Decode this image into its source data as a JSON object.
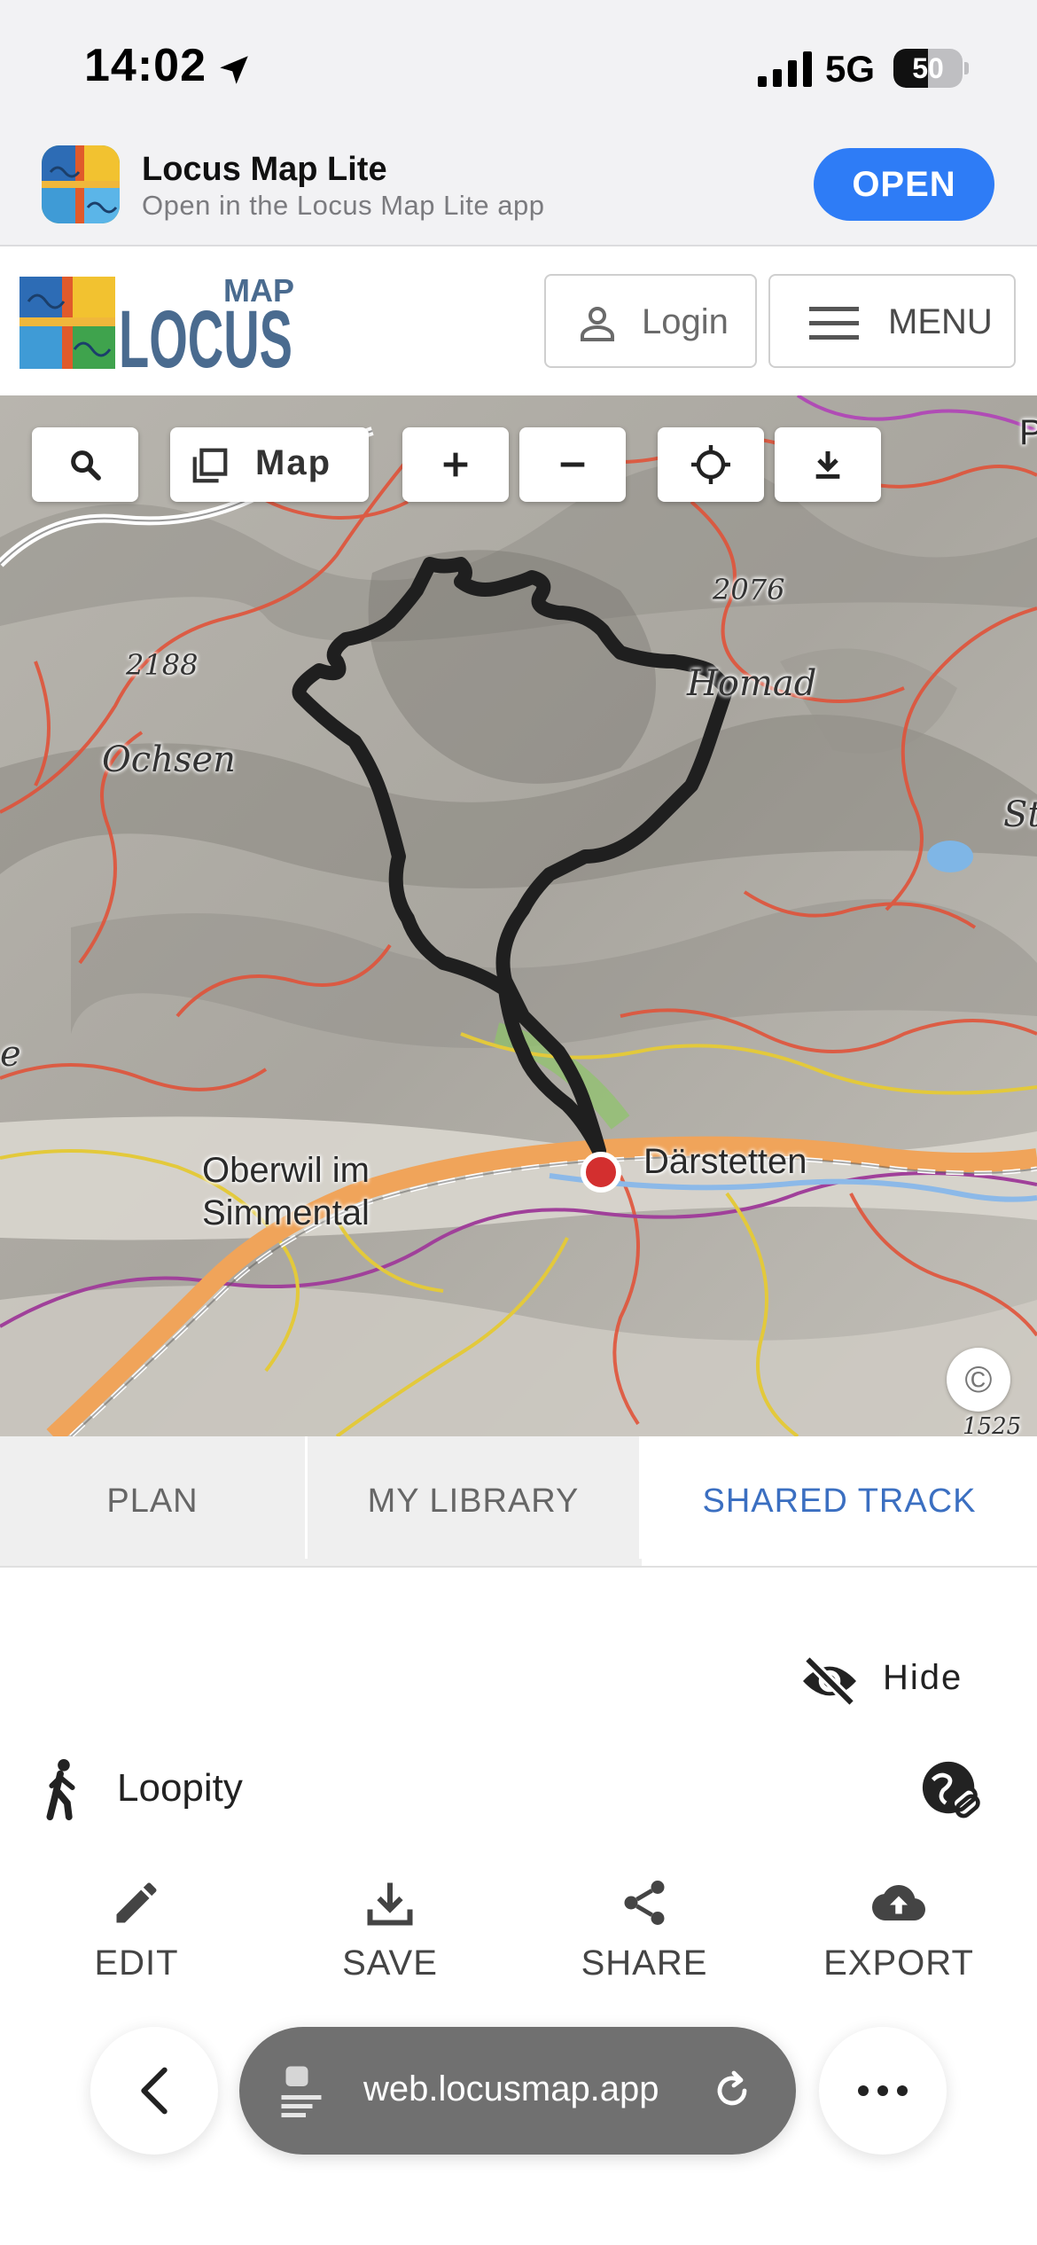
{
  "status_bar": {
    "time": "14:02",
    "network": "5G",
    "battery": "50",
    "battery_level": 0.5
  },
  "app_banner": {
    "title": "Locus Map Lite",
    "subtitle": "Open in the Locus Map Lite app",
    "open_label": "OPEN"
  },
  "header": {
    "logo_small": "MAP",
    "logo_big": "LOCUS",
    "login_label": "Login",
    "menu_label": "MENU"
  },
  "map": {
    "layer_label": "Map",
    "route_color": "#1f1f1f",
    "marker_color": "#d32f2f",
    "labels": {
      "peak_2076": "2076",
      "peak_2188": "2188",
      "homad": "Homad",
      "ochsen": "Ochsen",
      "st": "St",
      "e": "e",
      "p": "P",
      "darstetten": "Därstetten",
      "oberwil_1": "Oberwil im",
      "oberwil_2": "Simmental",
      "peak_1525": "1525"
    },
    "copyright": "©"
  },
  "tabs": {
    "plan": "PLAN",
    "library": "MY LIBRARY",
    "shared": "SHARED TRACK",
    "active_color": "#3b6fc1"
  },
  "panel": {
    "hide_label": "Hide",
    "track_name": "Loopity",
    "actions": {
      "edit": "EDIT",
      "save": "SAVE",
      "share": "SHARE",
      "export": "EXPORT"
    }
  },
  "browser": {
    "url": "web.locusmap.app"
  },
  "icons": [
    "location-arrow-icon",
    "signal-icon",
    "battery-icon",
    "app-icon",
    "user-icon",
    "hamburger-icon",
    "search-icon",
    "layers-icon",
    "plus-icon",
    "minus-icon",
    "locate-icon",
    "download-icon",
    "eye-slash-icon",
    "hiker-icon",
    "share-link-icon",
    "edit-icon",
    "save-icon",
    "share-icon",
    "export-icon",
    "back-icon",
    "page-icon",
    "reload-icon",
    "more-icon"
  ]
}
